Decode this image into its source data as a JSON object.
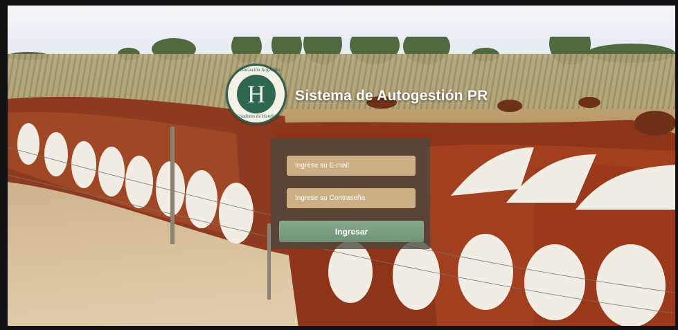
{
  "header": {
    "title": "Sistema de Autogestión PR",
    "logo": {
      "letter": "H",
      "ring_top": "Asociación Argentina",
      "ring_bottom": "Criadores de Hereford"
    }
  },
  "login": {
    "email_placeholder": "Ingrese su E-mail",
    "password_placeholder": "Ingrese su Contraseña",
    "submit_label": "Ingresar"
  },
  "colors": {
    "brand_green": "#2f6650",
    "button_green": "#7a9e82",
    "input_tan": "#d6b98c"
  }
}
